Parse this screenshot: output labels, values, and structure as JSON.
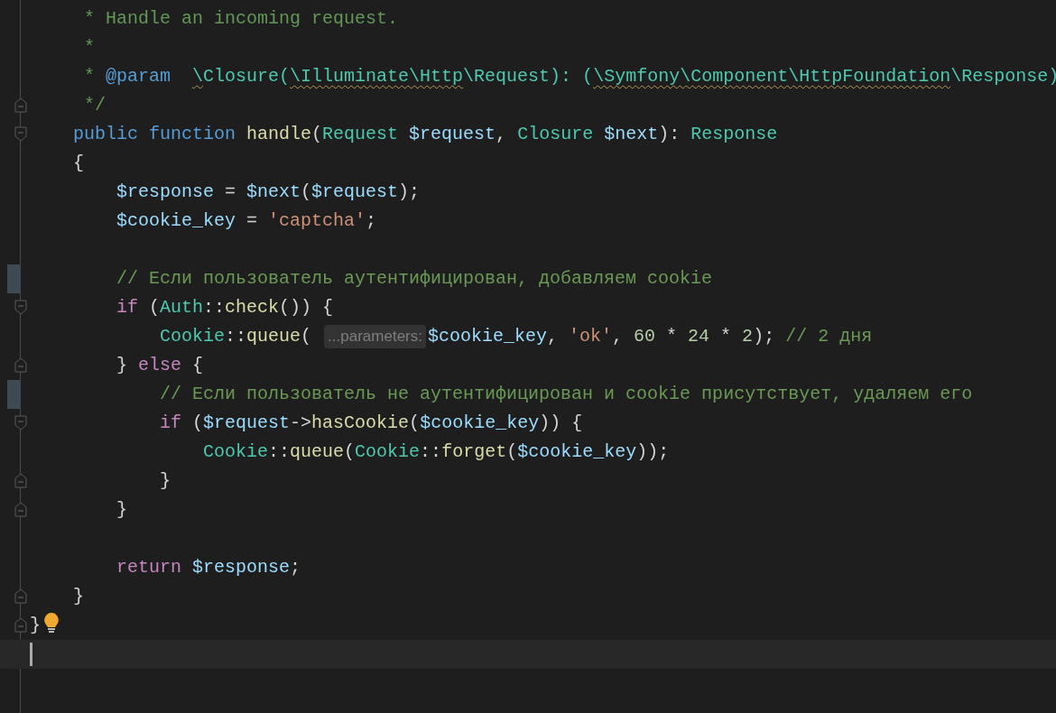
{
  "editor": {
    "lines": [
      {
        "tokens": [
          {
            "text": "     * Handle an incoming request.",
            "kind": "doc"
          }
        ]
      },
      {
        "tokens": [
          {
            "text": "     *",
            "kind": "doc"
          }
        ]
      },
      {
        "tokens": [
          {
            "text": "     * ",
            "kind": "doc"
          },
          {
            "text": "@param  ",
            "kind": "tag"
          },
          {
            "text": "\\",
            "kind": "type",
            "warning": true
          },
          {
            "text": "Closure(",
            "kind": "type"
          },
          {
            "text": "\\Illuminate\\Http",
            "kind": "type",
            "warning": true
          },
          {
            "text": "\\Request): (",
            "kind": "type"
          },
          {
            "text": "\\Symfony\\Component\\HttpFoundation",
            "kind": "type",
            "warning": true
          },
          {
            "text": "\\Response)",
            "kind": "type"
          }
        ]
      },
      {
        "fold": {
          "kind": "end"
        },
        "tokens": [
          {
            "text": "     */",
            "kind": "doc"
          }
        ]
      },
      {
        "fold": {
          "kind": "start"
        },
        "tokens": [
          {
            "text": "    public function ",
            "kind": "keyword"
          },
          {
            "text": "handle",
            "kind": "function"
          },
          {
            "text": "(",
            "kind": "plain"
          },
          {
            "text": "Request ",
            "kind": "type"
          },
          {
            "text": "$request",
            "kind": "variable"
          },
          {
            "text": ", ",
            "kind": "plain"
          },
          {
            "text": "Closure ",
            "kind": "type"
          },
          {
            "text": "$next",
            "kind": "variable"
          },
          {
            "text": "): ",
            "kind": "plain"
          },
          {
            "text": "Response",
            "kind": "type"
          }
        ]
      },
      {
        "tokens": [
          {
            "text": "    {",
            "kind": "plain"
          }
        ]
      },
      {
        "tokens": [
          {
            "text": "        $response",
            "kind": "variable"
          },
          {
            "text": " = ",
            "kind": "plain"
          },
          {
            "text": "$next",
            "kind": "variable"
          },
          {
            "text": "(",
            "kind": "plain"
          },
          {
            "text": "$request",
            "kind": "variable"
          },
          {
            "text": ");",
            "kind": "plain"
          }
        ]
      },
      {
        "tokens": [
          {
            "text": "        $cookie_key",
            "kind": "variable"
          },
          {
            "text": " = ",
            "kind": "plain"
          },
          {
            "text": "'captcha'",
            "kind": "string"
          },
          {
            "text": ";",
            "kind": "plain"
          }
        ]
      },
      {
        "kind": "blank"
      },
      {
        "changed": true,
        "tokens": [
          {
            "text": "        // Если пользователь аутентифицирован, добавляем cookie",
            "kind": "comment"
          }
        ]
      },
      {
        "fold": {
          "kind": "start"
        },
        "tokens": [
          {
            "text": "        if ",
            "kind": "control"
          },
          {
            "text": "(",
            "kind": "plain"
          },
          {
            "text": "Auth",
            "kind": "type"
          },
          {
            "text": "::",
            "kind": "plain"
          },
          {
            "text": "check",
            "kind": "function"
          },
          {
            "text": "()) {",
            "kind": "plain"
          }
        ]
      },
      {
        "tokens": [
          {
            "text": "            Cookie",
            "kind": "type"
          },
          {
            "text": "::",
            "kind": "plain"
          },
          {
            "text": "queue",
            "kind": "function"
          },
          {
            "text": "( ",
            "kind": "plain"
          },
          {
            "text": "...parameters:",
            "kind": "hint"
          },
          {
            "text": "$cookie_key",
            "kind": "variable"
          },
          {
            "text": ", ",
            "kind": "plain"
          },
          {
            "text": "'ok'",
            "kind": "string"
          },
          {
            "text": ", ",
            "kind": "plain"
          },
          {
            "text": "60",
            "kind": "number"
          },
          {
            "text": " * ",
            "kind": "plain"
          },
          {
            "text": "24",
            "kind": "number"
          },
          {
            "text": " * ",
            "kind": "plain"
          },
          {
            "text": "2",
            "kind": "number"
          },
          {
            "text": "); ",
            "kind": "plain"
          },
          {
            "text": "// 2 дня",
            "kind": "comment"
          }
        ]
      },
      {
        "fold": {
          "kind": "end"
        },
        "tokens": [
          {
            "text": "        } ",
            "kind": "plain"
          },
          {
            "text": "else",
            "kind": "control"
          },
          {
            "text": " {",
            "kind": "plain"
          }
        ]
      },
      {
        "changed": true,
        "tokens": [
          {
            "text": "            // Если пользователь не аутентифицирован и cookie присутствует, удаляем его",
            "kind": "comment"
          }
        ]
      },
      {
        "fold": {
          "kind": "start"
        },
        "tokens": [
          {
            "text": "            if ",
            "kind": "control"
          },
          {
            "text": "(",
            "kind": "plain"
          },
          {
            "text": "$request",
            "kind": "variable"
          },
          {
            "text": "->",
            "kind": "plain"
          },
          {
            "text": "hasCookie",
            "kind": "function"
          },
          {
            "text": "(",
            "kind": "plain"
          },
          {
            "text": "$cookie_key",
            "kind": "variable"
          },
          {
            "text": ")) {",
            "kind": "plain"
          }
        ]
      },
      {
        "tokens": [
          {
            "text": "                Cookie",
            "kind": "type"
          },
          {
            "text": "::",
            "kind": "plain"
          },
          {
            "text": "queue",
            "kind": "function"
          },
          {
            "text": "(",
            "kind": "plain"
          },
          {
            "text": "Cookie",
            "kind": "type"
          },
          {
            "text": "::",
            "kind": "plain"
          },
          {
            "text": "forget",
            "kind": "function"
          },
          {
            "text": "(",
            "kind": "plain"
          },
          {
            "text": "$cookie_key",
            "kind": "variable"
          },
          {
            "text": "));",
            "kind": "plain"
          }
        ]
      },
      {
        "fold": {
          "kind": "end"
        },
        "tokens": [
          {
            "text": "            }",
            "kind": "plain"
          }
        ]
      },
      {
        "fold": {
          "kind": "end"
        },
        "tokens": [
          {
            "text": "        }",
            "kind": "plain"
          }
        ]
      },
      {
        "kind": "blank"
      },
      {
        "tokens": [
          {
            "text": "        return ",
            "kind": "control"
          },
          {
            "text": "$response",
            "kind": "variable"
          },
          {
            "text": ";",
            "kind": "plain"
          }
        ]
      },
      {
        "fold": {
          "kind": "end"
        },
        "tokens": [
          {
            "text": "    }",
            "kind": "plain"
          }
        ]
      },
      {
        "fold": {
          "kind": "end"
        },
        "bulb": true,
        "tokens": [
          {
            "text": "}",
            "kind": "plain"
          }
        ]
      },
      {
        "current": true
      }
    ]
  }
}
